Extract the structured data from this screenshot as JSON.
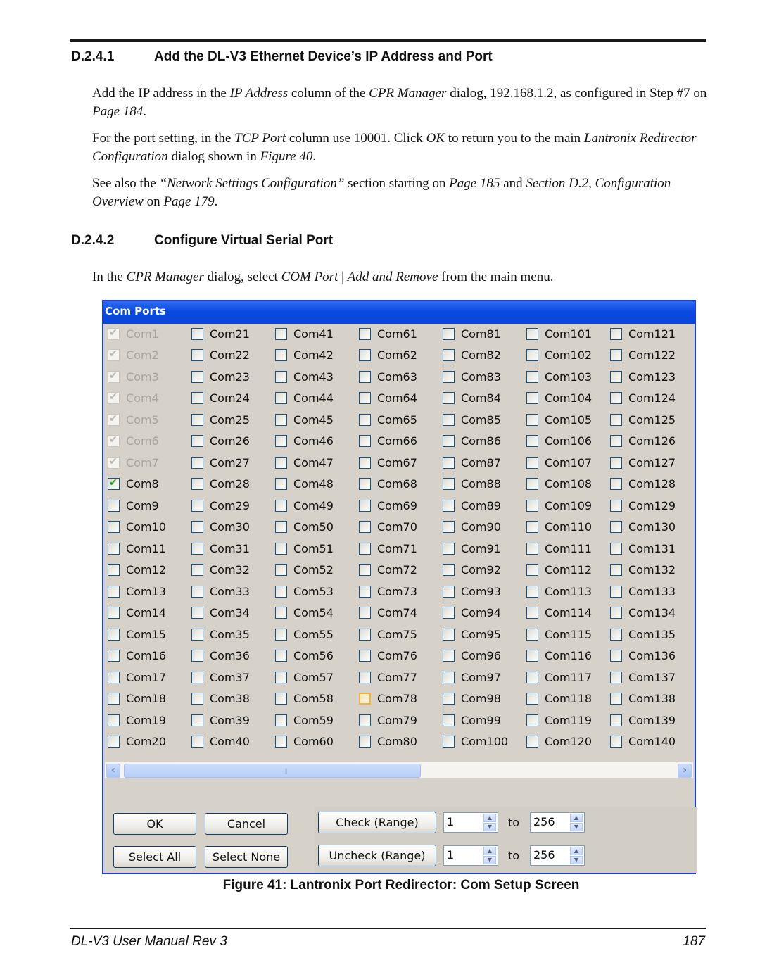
{
  "section1": {
    "number": "D.2.4.1",
    "title": "Add the DL-V3 Ethernet Device’s IP Address and Port",
    "p1": [
      {
        "t": "Add the IP address in the ",
        "i": false
      },
      {
        "t": "IP Address",
        "i": true
      },
      {
        "t": " column of the ",
        "i": false
      },
      {
        "t": "CPR Manager",
        "i": true
      },
      {
        "t": " dialog, 192.168.1.2, as configured in Step #7 on ",
        "i": false
      },
      {
        "t": "Page 184",
        "i": true
      },
      {
        "t": ".",
        "i": false
      }
    ],
    "p2": [
      {
        "t": "For the port setting, in the ",
        "i": false
      },
      {
        "t": "TCP Port",
        "i": true
      },
      {
        "t": " column use 10001. Click ",
        "i": false
      },
      {
        "t": "OK",
        "i": true
      },
      {
        "t": " to return you to the main ",
        "i": false
      },
      {
        "t": "Lantronix Redirector Configuration",
        "i": true
      },
      {
        "t": " dialog shown in ",
        "i": false
      },
      {
        "t": "Figure 40",
        "i": true
      },
      {
        "t": ".",
        "i": false
      }
    ],
    "p3": [
      {
        "t": "See also the ",
        "i": false
      },
      {
        "t": "“Network Settings Configuration”",
        "i": true
      },
      {
        "t": "  section starting on ",
        "i": false
      },
      {
        "t": "Page 185",
        "i": true
      },
      {
        "t": " and ",
        "i": false
      },
      {
        "t": "Section D.2, Configuration Overview",
        "i": true
      },
      {
        "t": " on ",
        "i": false
      },
      {
        "t": "Page 179",
        "i": true
      },
      {
        "t": ".",
        "i": false
      }
    ]
  },
  "section2": {
    "number": "D.2.4.2",
    "title": "Configure Virtual Serial Port",
    "p1": [
      {
        "t": "In the ",
        "i": false
      },
      {
        "t": "CPR Manager",
        "i": true
      },
      {
        "t": " dialog, select ",
        "i": false
      },
      {
        "t": "COM Port",
        "i": true
      },
      {
        "t": " | ",
        "i": false
      },
      {
        "t": "Add and Remove",
        "i": true
      },
      {
        "t": " from the main menu.",
        "i": false
      }
    ]
  },
  "dialog": {
    "title": "Com Ports",
    "ports_first": 1,
    "ports_last": 140,
    "rows_per_column": 20,
    "disabled_checked_ports": [
      1,
      2,
      3,
      4,
      5,
      6,
      7
    ],
    "checked_ports": [
      8
    ],
    "hovered_ports": [
      78
    ],
    "buttons": {
      "ok": "OK",
      "cancel": "Cancel",
      "select_all": "Select All",
      "select_none": "Select None",
      "check_range": "Check (Range)",
      "uncheck_range": "Uncheck (Range)"
    },
    "check_range": {
      "from": "1",
      "to_label": "to",
      "to": "256"
    },
    "uncheck_range": {
      "from": "1",
      "to_label": "to",
      "to": "256"
    },
    "icons": {
      "checkmark": "✔",
      "scroll_left": "‹",
      "scroll_right": "›",
      "scroll_grip": "|||",
      "spin_up": "▲",
      "spin_down": "▼"
    }
  },
  "caption": "Figure 41: Lantronix Port Redirector: Com Setup Screen",
  "footer": {
    "title": "DL-V3 User Manual Rev 3",
    "page": "187"
  }
}
